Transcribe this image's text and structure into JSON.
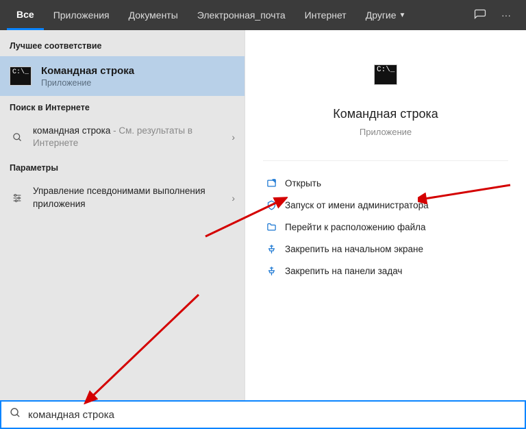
{
  "tabs": {
    "all": "Все",
    "apps": "Приложения",
    "docs": "Документы",
    "email": "Электронная_почта",
    "internet": "Интернет",
    "more": "Другие"
  },
  "left": {
    "best_match_header": "Лучшее соответствие",
    "best_match": {
      "title": "Командная строка",
      "type": "Приложение"
    },
    "web_header": "Поиск в Интернете",
    "web": {
      "query": "командная строка",
      "suffix": " - См. результаты в Интернете"
    },
    "settings_header": "Параметры",
    "setting": "Управление псевдонимами выполнения приложения"
  },
  "preview": {
    "title": "Командная строка",
    "type": "Приложение",
    "actions": {
      "open": "Открыть",
      "run_admin": "Запуск от имени администратора",
      "open_location": "Перейти к расположению файла",
      "pin_start": "Закрепить на начальном экране",
      "pin_taskbar": "Закрепить на панели задач"
    }
  },
  "search": {
    "value": "командная строка"
  },
  "cmd_prompt": "C:\\_"
}
